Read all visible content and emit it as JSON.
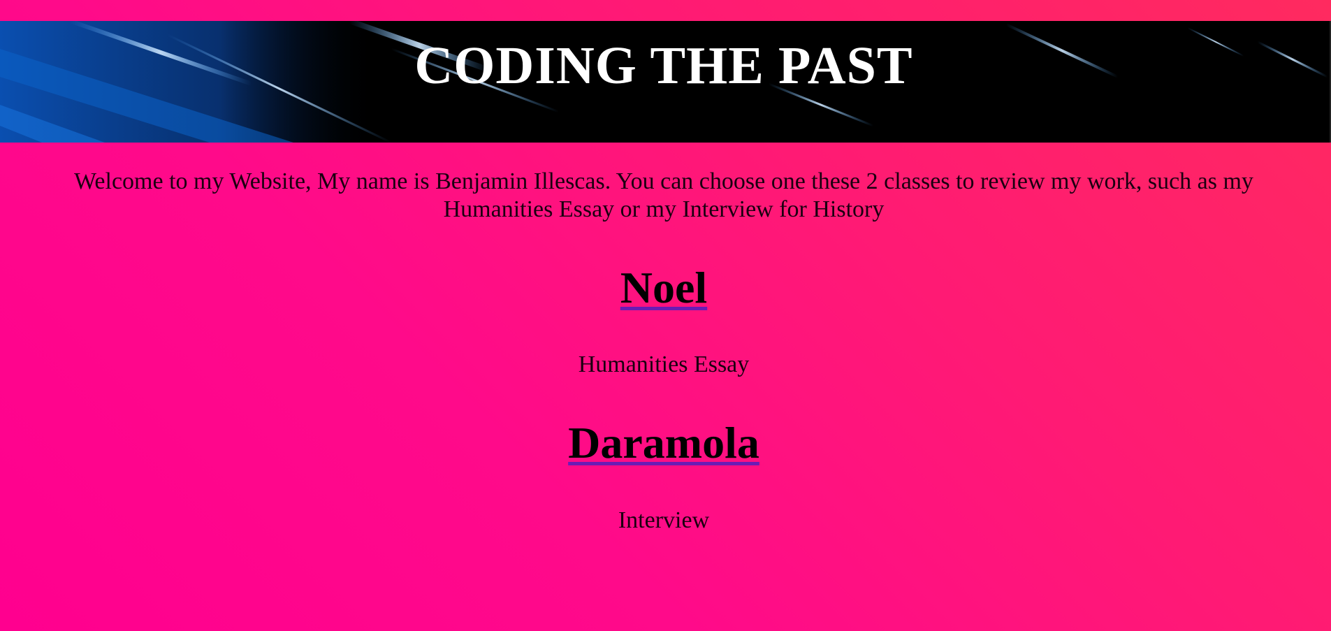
{
  "header": {
    "title": "CODING THE PAST"
  },
  "intro": {
    "text": "Welcome to my Website, My name is Benjamin Illescas. You can choose one these 2 classes to review my work, such as my Humanities Essay or my Interview for History"
  },
  "classes": [
    {
      "teacher": "Noel",
      "assignment": "Humanities Essay"
    },
    {
      "teacher": "Daramola",
      "assignment": "Interview"
    }
  ],
  "colors": {
    "background_start": "#ff008f",
    "background_end": "#ff2a5f",
    "banner_background": "#000000",
    "banner_streak": "#1e6fd9",
    "link_underline": "#6a1cb5"
  }
}
